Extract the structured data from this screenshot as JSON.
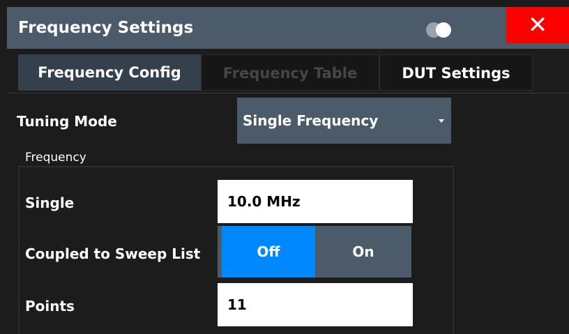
{
  "dialog": {
    "title": "Frequency Settings",
    "close_label": "✕"
  },
  "tabs": [
    {
      "label": "Frequency Config",
      "state": "active"
    },
    {
      "label": "Frequency Table",
      "state": "disabled"
    },
    {
      "label": "DUT Settings",
      "state": "normal"
    }
  ],
  "tuning_mode": {
    "label": "Tuning Mode",
    "value": "Single Frequency"
  },
  "frequency_group": {
    "legend": "Frequency",
    "single": {
      "label": "Single",
      "value": "10.0 MHz"
    },
    "coupled": {
      "label": "Coupled to Sweep List",
      "off_label": "Off",
      "on_label": "On",
      "selected": "Off"
    },
    "points": {
      "label": "Points",
      "value": "11"
    }
  },
  "colors": {
    "titlebar": "#4c5b6a",
    "close": "#ff0000",
    "selected_option": "#0088ff",
    "active_tab": "#34404c"
  }
}
